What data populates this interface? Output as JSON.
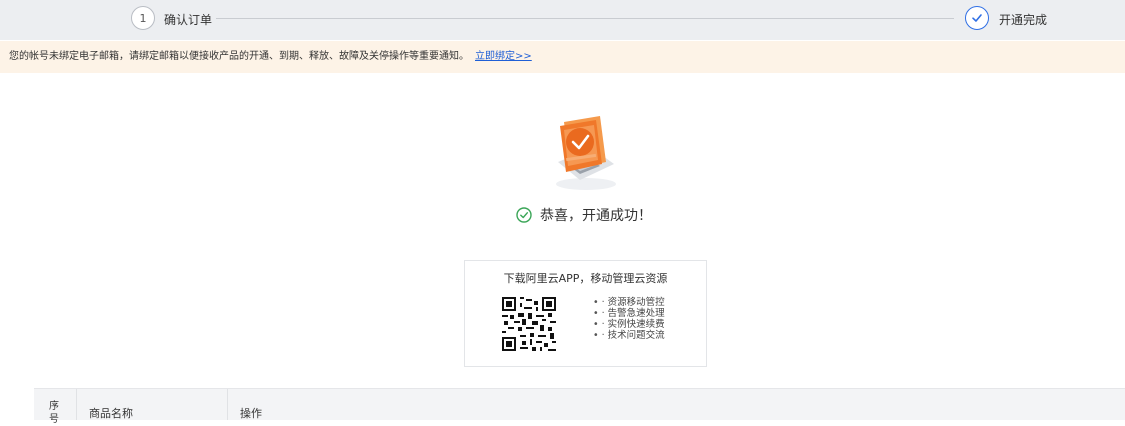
{
  "stepper": {
    "step1_number": "1",
    "step1_label": "确认订单",
    "step2_label": "开通完成"
  },
  "notice": {
    "text": "您的帐号未绑定电子邮箱，请绑定邮箱以便接收产品的开通、到期、释放、故障及关停操作等重要通知。",
    "link": "立即绑定>>"
  },
  "success": {
    "message": "恭喜，开通成功！"
  },
  "download": {
    "title": "下载阿里云APP，移动管理云资源",
    "features": [
      "资源移动管控",
      "告警急速处理",
      "实例快速续费",
      "技术问题交流"
    ]
  },
  "table": {
    "headers": [
      "序号",
      "商品名称",
      "操作"
    ]
  },
  "colors": {
    "accent": "#2f6fe5",
    "success": "#3aa557",
    "brand_orange": "#f0782a",
    "notice_bg": "#fdf3e7"
  }
}
